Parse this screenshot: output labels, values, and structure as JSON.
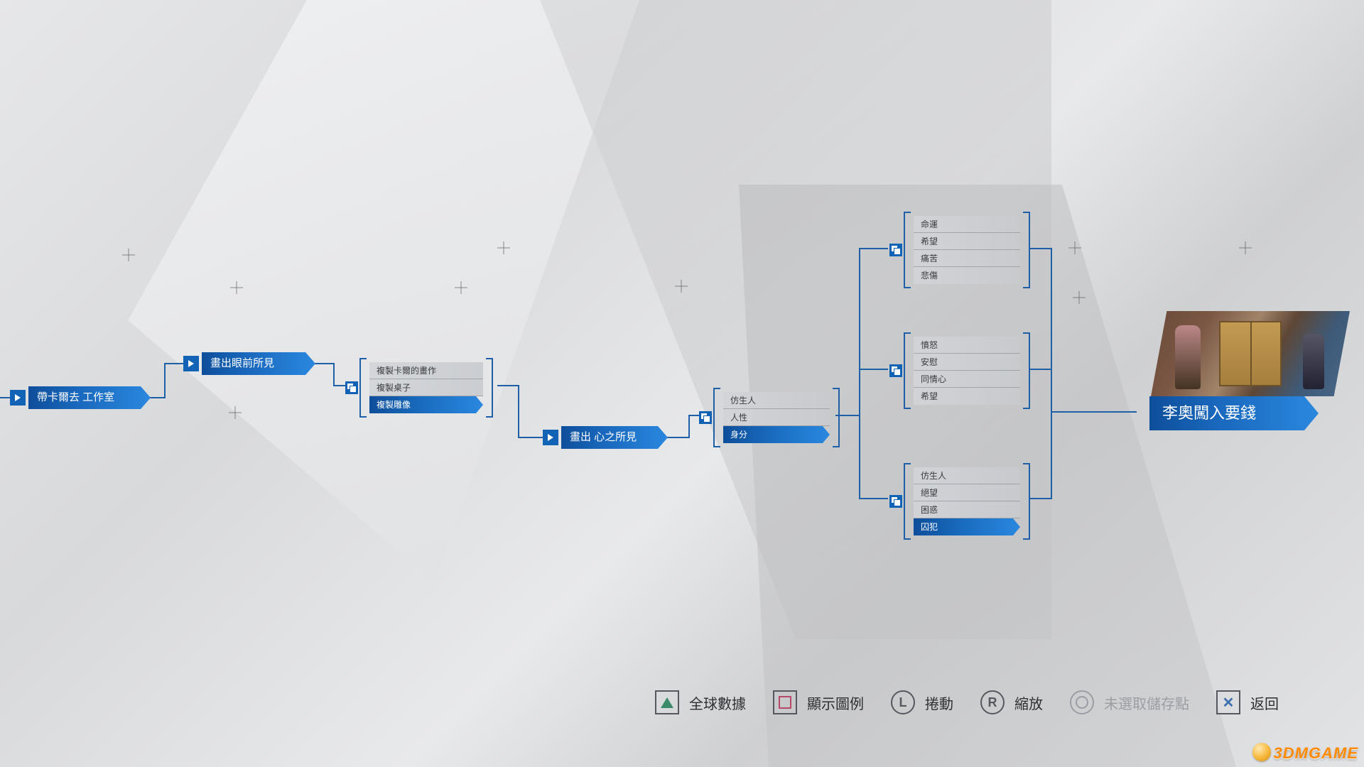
{
  "nodes": {
    "start": "帶卡爾去 工作室",
    "paint_see": "畫出眼前所見",
    "paint_heart": "畫出 心之所見",
    "leo": "李奧闖入要錢"
  },
  "choices": {
    "replicate": {
      "items": [
        "複製卡爾的畫作",
        "複製桌子",
        "複製雕像"
      ],
      "selected": 2
    },
    "subject": {
      "items": [
        "仿生人",
        "人性",
        "身分"
      ],
      "selected": 2
    },
    "feel_a": {
      "items": [
        "命運",
        "希望",
        "痛苦",
        "悲傷"
      ],
      "selected": -1
    },
    "feel_b": {
      "items": [
        "憤怒",
        "安慰",
        "同情心",
        "希望"
      ],
      "selected": -1
    },
    "feel_c": {
      "items": [
        "仿生人",
        "絕望",
        "困惑",
        "囚犯"
      ],
      "selected": 3
    }
  },
  "buttons": {
    "global": "全球數據",
    "legend": "顯示圖例",
    "scroll": "捲動",
    "zoom": "縮放",
    "nosave": "未選取儲存點",
    "back": "返回"
  },
  "watermark": "3DMGAME"
}
